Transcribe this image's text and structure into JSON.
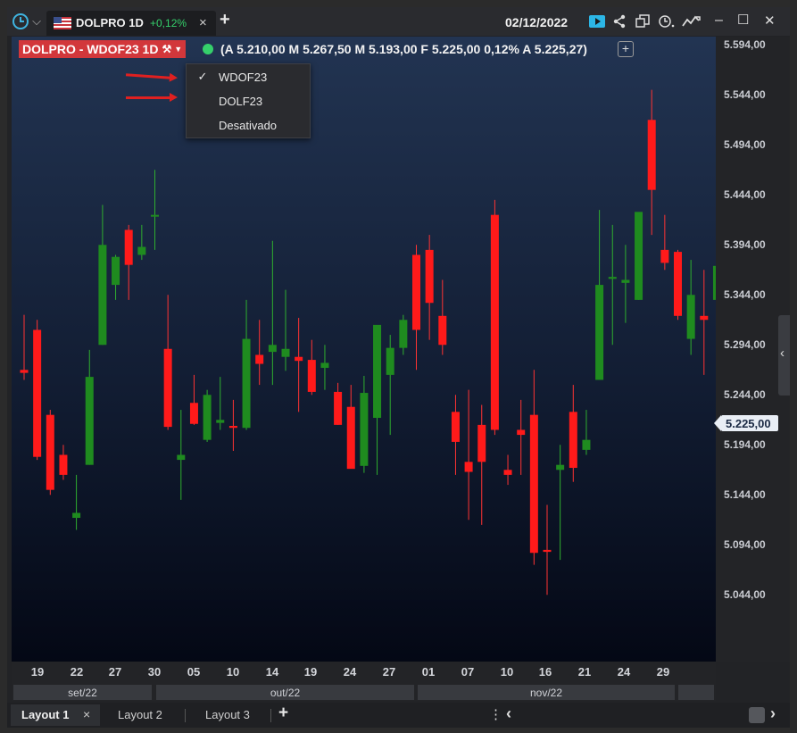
{
  "titlebar": {
    "tab_label": "DOLPRO 1D",
    "tab_change": "+0,12%",
    "date": "02/12/2022",
    "close_tab": "×",
    "add_tab": "+",
    "clock_caret": "⌵",
    "win_min": "–",
    "win_max": "☐",
    "win_close": "✕"
  },
  "legend": {
    "symbol_label": "DOLPRO - WDOF23 1D",
    "quote": "(A 5.210,00 M 5.267,50 M 5.193,00 F 5.225,00 0,12% A 5.225,27)",
    "add_button": "+"
  },
  "dropdown": {
    "items": [
      {
        "label": "WDOF23",
        "checked": true
      },
      {
        "label": "DOLF23",
        "checked": false
      },
      {
        "label": "Desativado",
        "checked": false
      }
    ],
    "check_glyph": "✓"
  },
  "price_axis": {
    "labels": [
      "5.594,00",
      "5.544,00",
      "5.494,00",
      "5.444,00",
      "5.394,00",
      "5.344,00",
      "5.294,00",
      "5.244,00",
      "5.194,00",
      "5.144,00",
      "5.094,00",
      "5.044,00"
    ],
    "current_price": "5.225,00",
    "collapse_glyph": "‹"
  },
  "time_axis": {
    "days": [
      "19",
      "22",
      "27",
      "30",
      "05",
      "10",
      "14",
      "19",
      "24",
      "27",
      "01",
      "07",
      "10",
      "16",
      "21",
      "24",
      "29"
    ],
    "months": [
      "set/22",
      "out/22",
      "nov/22"
    ]
  },
  "footer": {
    "tabs": [
      {
        "label": "Layout 1",
        "active": true
      },
      {
        "label": "Layout 2",
        "active": false
      },
      {
        "label": "Layout 3",
        "active": false
      }
    ],
    "close_glyph": "×",
    "add_glyph": "+",
    "menu_glyph": "⋮",
    "prev_glyph": "‹",
    "next_glyph": "›"
  },
  "colors": {
    "up": "#1f8b1f",
    "down": "#ff1a1a",
    "wick_up": "#2fae2f",
    "wick_down": "#ff3333",
    "accent_green": "#35d06b",
    "badge_red": "#d2373b"
  },
  "chart_data": {
    "type": "candlestick",
    "ylim": [
      5000,
      5620
    ],
    "x": [
      "19",
      "20",
      "21",
      "22",
      "23",
      "26",
      "27",
      "28",
      "29",
      "30",
      "03",
      "04",
      "05",
      "06",
      "07",
      "10",
      "11",
      "13",
      "14",
      "17",
      "18",
      "19",
      "20",
      "21",
      "24",
      "25",
      "26",
      "27",
      "28",
      "31",
      "01",
      "03",
      "04",
      "07",
      "08",
      "09",
      "10",
      "11",
      "14",
      "16",
      "17",
      "18",
      "21",
      "22",
      "23",
      "24",
      "25",
      "28",
      "29",
      "30",
      "01",
      "02"
    ],
    "ohlc": [
      [
        5275,
        5330,
        5265,
        5272
      ],
      [
        5315,
        5325,
        5185,
        5188
      ],
      [
        5230,
        5235,
        5150,
        5155
      ],
      [
        5190,
        5200,
        5165,
        5170
      ],
      [
        5127,
        5170,
        5115,
        5132
      ],
      [
        5180,
        5295,
        5180,
        5268
      ],
      [
        5300,
        5440,
        5300,
        5400
      ],
      [
        5360,
        5390,
        5345,
        5388
      ],
      [
        5415,
        5420,
        5345,
        5380
      ],
      [
        5390,
        5420,
        5385,
        5398
      ],
      [
        5430,
        5475,
        5395,
        5430
      ],
      [
        5296,
        5350,
        5215,
        5218
      ],
      [
        5185,
        5235,
        5145,
        5190
      ],
      [
        5242,
        5270,
        5220,
        5221
      ],
      [
        5205,
        5255,
        5203,
        5250
      ],
      [
        5222,
        5268,
        5215,
        5225
      ],
      [
        5219,
        5245,
        5194,
        5217
      ],
      [
        5217,
        5345,
        5215,
        5306
      ],
      [
        5290,
        5325,
        5260,
        5281
      ],
      [
        5293,
        5404,
        5260,
        5300
      ],
      [
        5288,
        5355,
        5274,
        5296
      ],
      [
        5288,
        5327,
        5233,
        5284
      ],
      [
        5285,
        5305,
        5250,
        5253
      ],
      [
        5277,
        5300,
        5255,
        5282
      ],
      [
        5253,
        5262,
        5220,
        5220
      ],
      [
        5238,
        5260,
        5177,
        5176
      ],
      [
        5179,
        5269,
        5172,
        5252
      ],
      [
        5227,
        5260,
        5170,
        5320
      ],
      [
        5270,
        5310,
        5210,
        5297
      ],
      [
        5297,
        5330,
        5290,
        5325
      ],
      [
        5390,
        5400,
        5275,
        5315
      ],
      [
        5395,
        5410,
        5305,
        5342
      ],
      [
        5329,
        5365,
        5290,
        5300
      ],
      [
        5233,
        5250,
        5170,
        5203
      ],
      [
        5183,
        5255,
        5125,
        5173
      ],
      [
        5220,
        5240,
        5120,
        5183
      ],
      [
        5430,
        5445,
        5210,
        5215
      ],
      [
        5175,
        5190,
        5160,
        5170
      ],
      [
        5215,
        5245,
        5170,
        5210
      ],
      [
        5230,
        5275,
        5080,
        5092
      ],
      [
        5095,
        5140,
        5050,
        5093
      ],
      [
        5175,
        5200,
        5085,
        5180
      ],
      [
        5233,
        5260,
        5163,
        5177
      ],
      [
        5195,
        5235,
        5190,
        5205
      ],
      [
        5265,
        5435,
        5265,
        5360
      ],
      [
        5366,
        5420,
        5300,
        5368
      ],
      [
        5362,
        5400,
        5322,
        5365
      ],
      [
        5345,
        5428,
        5345,
        5433
      ],
      [
        5525,
        5555,
        5410,
        5455
      ],
      [
        5395,
        5430,
        5375,
        5382
      ],
      [
        5393,
        5395,
        5325,
        5329
      ],
      [
        5306,
        5385,
        5290,
        5350
      ],
      [
        5329,
        5375,
        5270,
        5325
      ],
      [
        5345,
        5400,
        5290,
        5379
      ],
      [
        5330,
        5365,
        5310,
        5322
      ],
      [
        5330,
        5420,
        5330,
        5410
      ],
      [
        5420,
        5430,
        5340,
        5360
      ],
      [
        5325,
        5325,
        5260,
        5262
      ],
      [
        5282,
        5330,
        5200,
        5207
      ],
      [
        5224,
        5245,
        5205,
        5218
      ],
      [
        5211,
        5265,
        5192,
        5225
      ]
    ]
  }
}
